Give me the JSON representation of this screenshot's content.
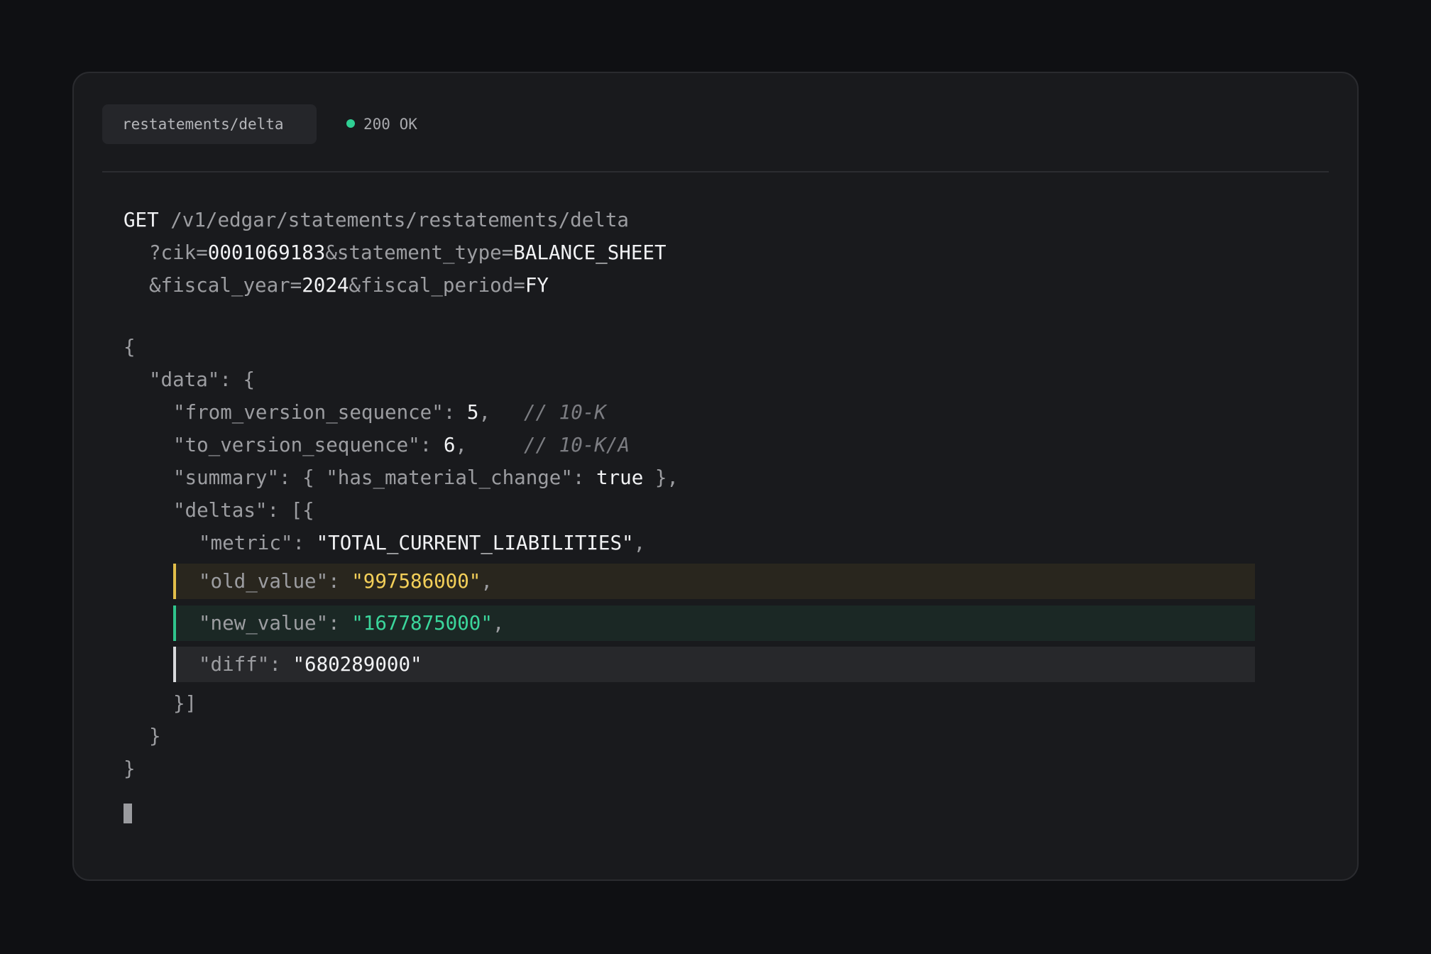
{
  "header": {
    "tab_label": "restatements/delta",
    "status_text": "200 OK",
    "status_color": "#2fcf93"
  },
  "request": {
    "method": "GET",
    "path": "/v1/edgar/statements/restatements/delta",
    "param_cik_key": "?cik=",
    "param_cik_value": "0001069183",
    "param_statement_type_key": "&statement_type=",
    "param_statement_type_value": "BALANCE_SHEET",
    "param_fiscal_year_key": "&fiscal_year=",
    "param_fiscal_year_value": "2024",
    "param_fiscal_period_key": "&fiscal_period=",
    "param_fiscal_period_value": "FY"
  },
  "response": {
    "open_brace": "{",
    "data_key": "\"data\": {",
    "from_key": "\"from_version_sequence\": ",
    "from_value": "5",
    "from_comma": ",",
    "from_comment": "// 10-K",
    "to_key": "\"to_version_sequence\": ",
    "to_value": "6",
    "to_comma": ",",
    "to_comment": "// 10-K/A",
    "summary_prefix": "\"summary\": { \"has_material_change\": ",
    "summary_value": "true",
    "summary_suffix": " },",
    "deltas_key": "\"deltas\": [{",
    "metric_key": "\"metric\": ",
    "metric_value": "\"TOTAL_CURRENT_LIABILITIES\"",
    "metric_comma": ",",
    "old_key": "\"old_value\": ",
    "old_value": "\"997586000\"",
    "old_comma": ",",
    "new_key": "\"new_value\": ",
    "new_value": "\"1677875000\"",
    "new_comma": ",",
    "diff_key": "\"diff\": ",
    "diff_value": "\"680289000\"",
    "deltas_close": "}]",
    "data_close": "}",
    "close_brace": "}"
  },
  "colors": {
    "old_value": "#f3cf59",
    "new_value": "#3bd69c",
    "background": "#0f1013",
    "card": "#191a1d"
  }
}
